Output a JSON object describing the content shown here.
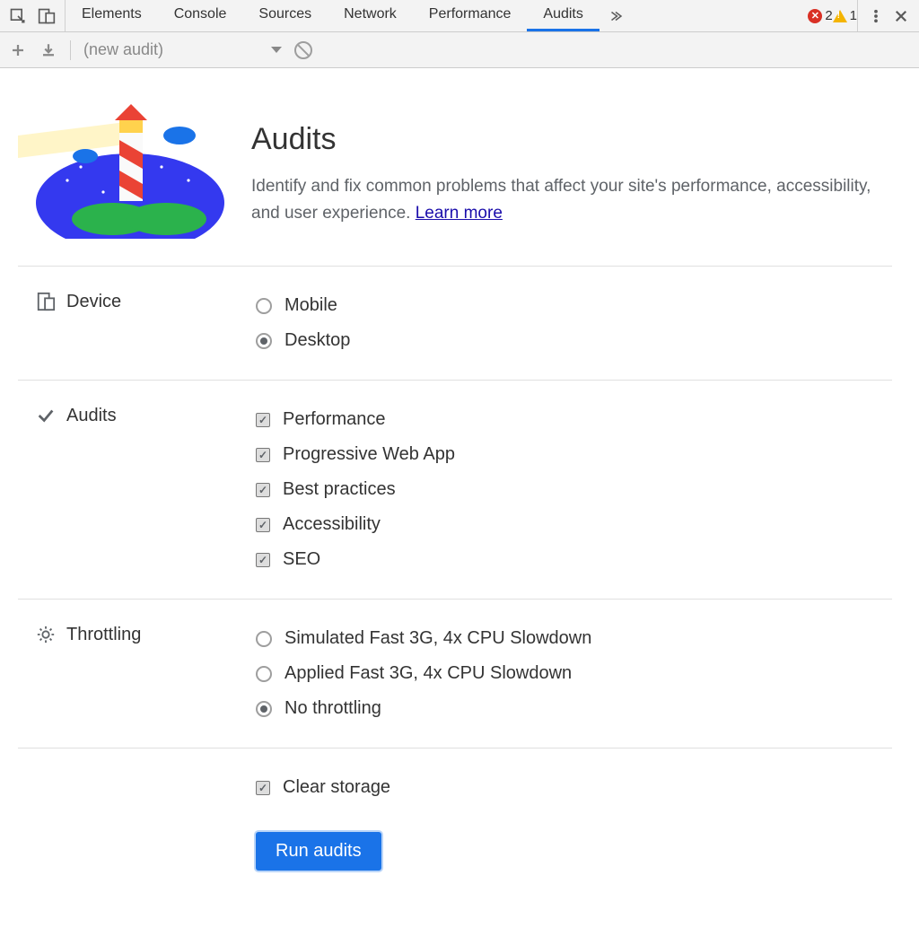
{
  "top": {
    "tabs": [
      "Elements",
      "Console",
      "Sources",
      "Network",
      "Performance",
      "Audits"
    ],
    "active_tab_index": 5,
    "error_count": "2",
    "warning_count": "1"
  },
  "subbar": {
    "dropdown_label": "(new audit)"
  },
  "header": {
    "title": "Audits",
    "description_a": "Identify and fix common problems that affect your site's performance, accessibility, and user experience. ",
    "learn_more": "Learn more"
  },
  "sections": {
    "device": {
      "title": "Device",
      "options": [
        "Mobile",
        "Desktop"
      ],
      "selected_index": 1
    },
    "audits": {
      "title": "Audits",
      "options": [
        "Performance",
        "Progressive Web App",
        "Best practices",
        "Accessibility",
        "SEO"
      ]
    },
    "throttling": {
      "title": "Throttling",
      "options": [
        "Simulated Fast 3G, 4x CPU Slowdown",
        "Applied Fast 3G, 4x CPU Slowdown",
        "No throttling"
      ],
      "selected_index": 2
    },
    "clear_storage": "Clear storage"
  },
  "run_button": "Run audits"
}
